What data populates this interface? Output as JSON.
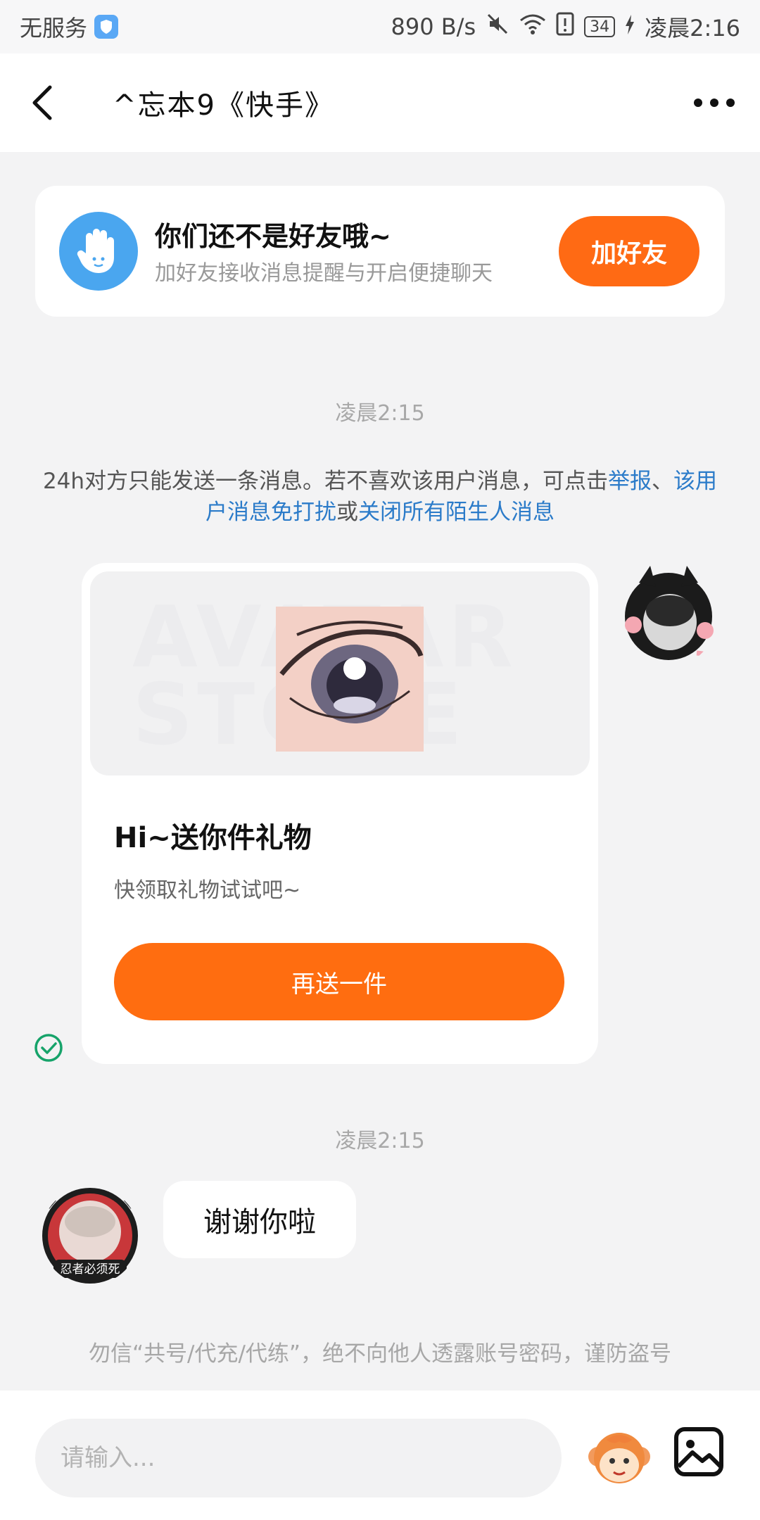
{
  "status_bar": {
    "carrier": "无服务",
    "network_speed": "890 B/s",
    "battery": "34",
    "time": "凌晨2:16"
  },
  "header": {
    "title": "^忘本9《快手》"
  },
  "friend_prompt": {
    "title": "你们还不是好友哦~",
    "subtitle": "加好友接收消息提醒与开启便捷聊天",
    "button": "加好友"
  },
  "chat": {
    "time_1": "凌晨2:15",
    "notice_prefix": "24h对方只能发送一条消息。若不喜欢该用户消息，可点击",
    "notice_link_report": "举报",
    "notice_sep1": "、",
    "notice_link_mute": "该用户消息免打扰",
    "notice_sep2": "或",
    "notice_link_close": "关闭所有陌生人消息",
    "gift_card": {
      "watermark": "AVATAR STORE",
      "title": "Hi~送你件礼物",
      "subtitle": "快领取礼物试试吧~",
      "button": "再送一件"
    },
    "time_2": "凌晨2:15",
    "reply_message": "谢谢你啦",
    "other_avatar_caption": "忍者必须死",
    "bottom_warning": "勿信“共号/代充/代练”，绝不向他人透露账号密码，谨防盗号"
  },
  "input": {
    "placeholder": "请输入..."
  },
  "colors": {
    "accent": "#ff6a14",
    "link": "#2b7bc9",
    "check": "#16a36a"
  }
}
